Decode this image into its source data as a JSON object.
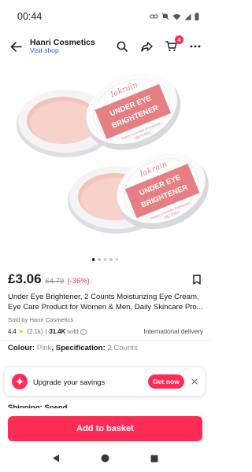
{
  "status_bar": {
    "time": "00:44",
    "icons": [
      "link-icon",
      "mute-icon",
      "wifi-icon",
      "signal-icon",
      "battery-icon"
    ]
  },
  "header": {
    "shop_name": "Hanri Cosmetics",
    "visit_shop": "Visit shop",
    "cart_count": "4",
    "icons": [
      "back-arrow-icon",
      "search-icon",
      "share-icon",
      "cart-icon",
      "more-icon"
    ]
  },
  "gallery": {
    "brand_text": "Iakrain",
    "label_line1": "UNDER EYE",
    "label_line2": "BRIGHTENER",
    "label_small": "Instant Concealer Brightening",
    "label_weight": "10g / 0.35oz",
    "slides": 5,
    "active_slide": 1
  },
  "product": {
    "price": "£3.06",
    "original_price": "£4.79",
    "discount": "(-36%)",
    "title": "Under Eye Brightener, 2 Counts Moisturizing Eye Cream, Eye Care Product for Women & Men, Daily Skincare Pro...",
    "sold_by": "Sold by Hanri Cosmetics",
    "rating": "4.4",
    "review_count": "(2.1k)",
    "sold_count": "31.4K",
    "sold_label": "sold",
    "delivery": "International delivery",
    "colour_label": "Colour:",
    "colour_value": "Pink",
    "spec_label": "Specification:",
    "spec_value": "2 Counts"
  },
  "promo": {
    "text": "Upgrade your savings",
    "button": "Get now"
  },
  "shipping_peek": "Shipping: Spend...",
  "cta": {
    "add_to_basket": "Add to basket"
  },
  "colors": {
    "accent": "#fe2c55",
    "link": "#2b5fd9",
    "product_pink": "#f2c9c2",
    "label_pink": "#e67f84",
    "text_primary": "#161823",
    "text_secondary": "#8a8b91"
  }
}
